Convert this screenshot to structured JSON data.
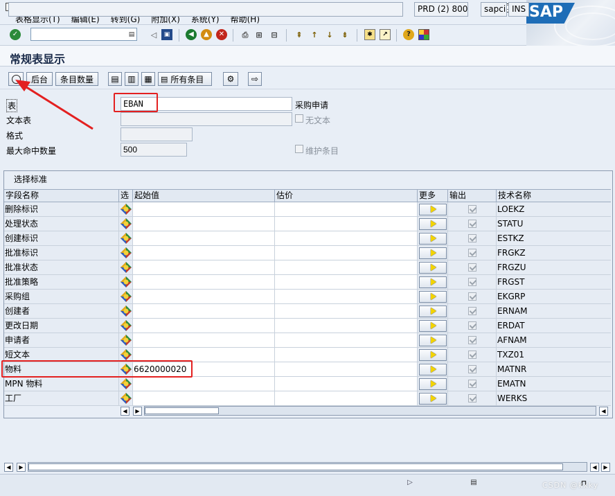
{
  "menu": {
    "items": [
      "表格显示(T)",
      "编辑(E)",
      "转到(G)",
      "附加(X)",
      "系统(Y)",
      "帮助(H)"
    ],
    "logo": "SAP"
  },
  "toolbar": {
    "command_value": ""
  },
  "title": "常规表显示",
  "app_toolbar": {
    "back_label": "后台",
    "count_label": "条目数量",
    "all_entries_label": "所有条目"
  },
  "form": {
    "table_label": "表",
    "table_value": "EBAN",
    "table_desc": "采购申请",
    "text_table_label": "文本表",
    "text_table_value": "",
    "no_text_label": "无文本",
    "format_label": "格式",
    "format_value": "",
    "max_hits_label": "最大命中数量",
    "max_hits_value": "500",
    "maintain_label": "维护条目"
  },
  "selection": {
    "title": "选择标准",
    "columns": [
      "字段名称",
      "选",
      "起始值",
      "估价",
      "更多",
      "输出",
      "技术名称"
    ],
    "rows": [
      {
        "name": "删除标识",
        "low": "",
        "high": "",
        "tech": "LOEKZ"
      },
      {
        "name": "处理状态",
        "low": "",
        "high": "",
        "tech": "STATU"
      },
      {
        "name": "创建标识",
        "low": "",
        "high": "",
        "tech": "ESTKZ"
      },
      {
        "name": "批准标识",
        "low": "",
        "high": "",
        "tech": "FRGKZ"
      },
      {
        "name": "批准状态",
        "low": "",
        "high": "",
        "tech": "FRGZU"
      },
      {
        "name": "批准策略",
        "low": "",
        "high": "",
        "tech": "FRGST"
      },
      {
        "name": "采购组",
        "low": "",
        "high": "",
        "tech": "EKGRP"
      },
      {
        "name": "创建者",
        "low": "",
        "high": "",
        "tech": "ERNAM"
      },
      {
        "name": "更改日期",
        "low": "",
        "high": "",
        "tech": "ERDAT"
      },
      {
        "name": "申请者",
        "low": "",
        "high": "",
        "tech": "AFNAM"
      },
      {
        "name": "短文本",
        "low": "",
        "high": "",
        "tech": "TXZ01"
      },
      {
        "name": "物料",
        "low": "6620000020",
        "high": "",
        "tech": "MATNR"
      },
      {
        "name": "MPN 物料",
        "low": "",
        "high": "",
        "tech": "EMATN"
      },
      {
        "name": "工厂",
        "low": "",
        "high": "",
        "tech": "WERKS"
      }
    ]
  },
  "status": {
    "system": "PRD (2) 800",
    "server": "sapci",
    "mode": "INS"
  },
  "watermark": "CSDN @kxky",
  "colors": {
    "annotation_red": "#e32020",
    "sap_blue": "#1e6db7"
  }
}
